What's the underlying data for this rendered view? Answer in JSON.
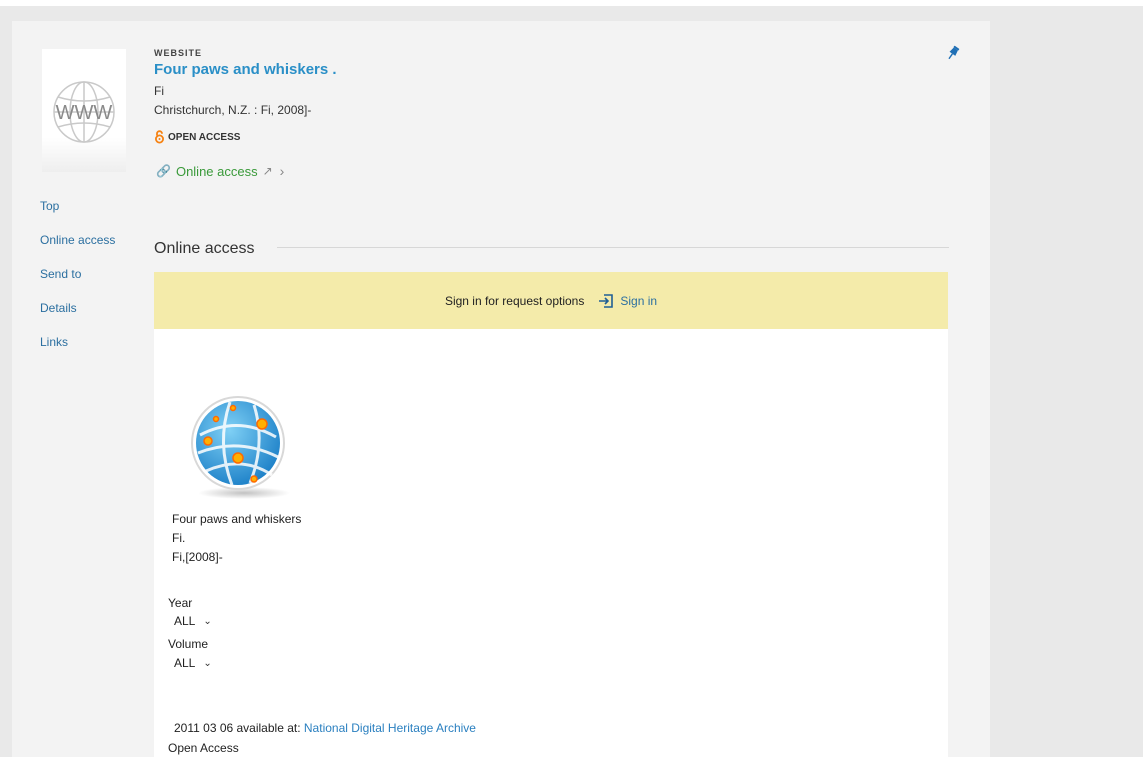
{
  "record": {
    "type_label": "WEBSITE",
    "title": "Four paws and whiskers .",
    "author": "Fi",
    "publication": "Christchurch, N.Z. : Fi, 2008]-",
    "open_access_label": "OPEN ACCESS",
    "online_access_link": "Online access"
  },
  "thumbnail": {
    "text": "WWW"
  },
  "sidenav": {
    "items": [
      "Top",
      "Online access",
      "Send to",
      "Details",
      "Links"
    ]
  },
  "section": {
    "title": "Online access"
  },
  "signin_bar": {
    "prompt": "Sign in for request options",
    "link": "Sign in"
  },
  "resource": {
    "title": "Four paws and whiskers",
    "line2": "Fi.",
    "line3": "Fi,[2008]-",
    "year_label": "Year",
    "year_value": "ALL",
    "volume_label": "Volume",
    "volume_value": "ALL",
    "availability_text": "2011 03 06 available at:",
    "availability_link": "National Digital Heritage Archive",
    "access_note": "Open Access"
  },
  "colors": {
    "title_link": "#2a8fc7",
    "online_access_green": "#3a9a3a",
    "signin_bar_bg": "#f4ebaa",
    "open_access_orange": "#f68212",
    "pin_blue": "#1f6fb5"
  }
}
